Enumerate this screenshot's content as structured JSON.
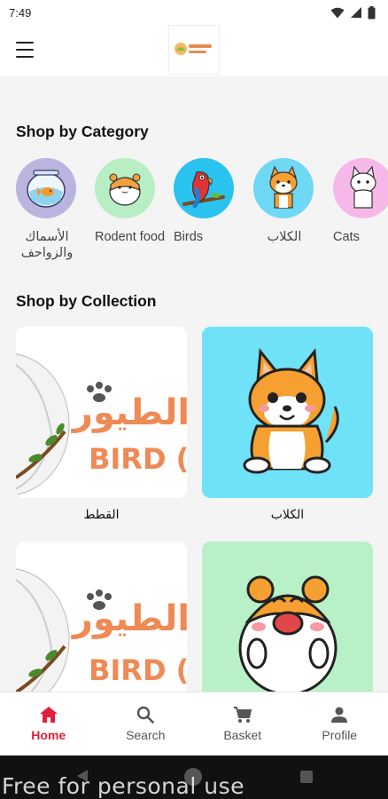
{
  "status_bar": {
    "time": "7:49"
  },
  "app_bar": {
    "logo_text": "بيت الطيور"
  },
  "sections": {
    "category_title": "Shop by Category",
    "collection_title": "Shop by Collection"
  },
  "categories": [
    {
      "label": "الأسماك والزواحف",
      "icon": "fishbowl-icon",
      "bg": "#b9b5de"
    },
    {
      "label": "Rodent food",
      "icon": "hamster-icon",
      "bg": "#b8eec4"
    },
    {
      "label": "Birds",
      "icon": "parrot-icon",
      "bg": "#2ac3f0"
    },
    {
      "label": "الكلاب",
      "icon": "dog-icon",
      "bg": "#6ed8f5"
    },
    {
      "label": "Cats",
      "icon": "cat-icon",
      "bg": "#f6b8e8"
    }
  ],
  "collections": [
    {
      "label": "القطط",
      "image_text": "الطيور",
      "image_subtext": "BIRD (",
      "bg": "#ffffff"
    },
    {
      "label": "الكلاب",
      "icon": "dog-icon",
      "bg": "#6fe2f7"
    },
    {
      "label": "",
      "image_text": "الطيور",
      "image_subtext": "BIRD (",
      "bg": "#ffffff"
    },
    {
      "label": "",
      "icon": "hamster-icon",
      "bg": "#b8f0c8"
    }
  ],
  "bottom_nav": [
    {
      "label": "Home",
      "icon": "home-icon",
      "active": true
    },
    {
      "label": "Search",
      "icon": "search-icon",
      "active": false
    },
    {
      "label": "Basket",
      "icon": "cart-icon",
      "active": false
    },
    {
      "label": "Profile",
      "icon": "person-icon",
      "active": false
    }
  ],
  "watermark": "Free for personal use",
  "colors": {
    "accent": "#e0203a",
    "background": "#f4f4f4"
  }
}
